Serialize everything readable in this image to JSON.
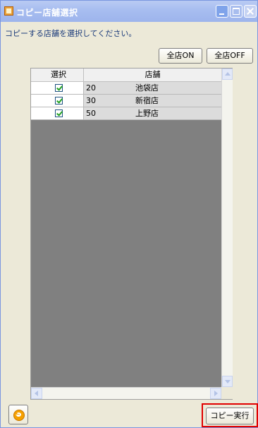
{
  "window": {
    "title": "コピー店舗選択"
  },
  "instruction": "コピーする店舗を選択してください。",
  "toolbar": {
    "all_on_label": "全店ON",
    "all_off_label": "全店OFF"
  },
  "grid": {
    "columns": [
      "選択",
      "店舗"
    ],
    "rows": [
      {
        "checked": true,
        "code": "20",
        "name": "池袋店"
      },
      {
        "checked": true,
        "code": "30",
        "name": "新宿店"
      },
      {
        "checked": true,
        "code": "50",
        "name": "上野店"
      }
    ]
  },
  "footer": {
    "back_icon": "back-arrow-icon",
    "exec_label": "コピー実行"
  },
  "colors": {
    "titlebar": "#a7bdf0",
    "highlight_border": "#e00000",
    "grid_empty": "#808080"
  }
}
